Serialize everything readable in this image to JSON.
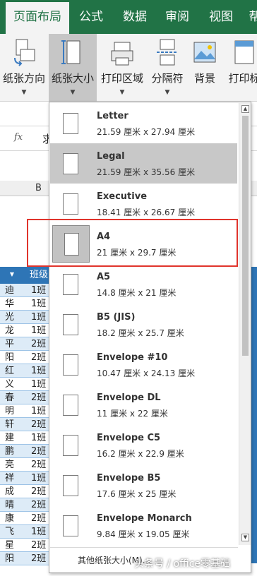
{
  "ribbon_tabs": [
    {
      "label": "页面布局",
      "active": true
    },
    {
      "label": "公式"
    },
    {
      "label": "数据"
    },
    {
      "label": "审阅"
    },
    {
      "label": "视图"
    },
    {
      "label": "帮"
    }
  ],
  "ribbon_buttons": [
    {
      "label": "纸张方向",
      "icon": "orientation-icon"
    },
    {
      "label": "纸张大小",
      "icon": "paper-size-icon",
      "selected": true
    },
    {
      "label": "打印区域",
      "icon": "print-area-icon"
    },
    {
      "label": "分隔符",
      "icon": "breaks-icon"
    },
    {
      "label": "背景",
      "icon": "background-icon"
    },
    {
      "label": "打印标",
      "icon": "print-titles-icon"
    }
  ],
  "formula_bar": {
    "fx_label": "fx",
    "value": "求"
  },
  "column_header": {
    "b": "B"
  },
  "table": {
    "header_col1": "▼",
    "header_col2": "班级",
    "rows": [
      [
        "迪",
        "1班"
      ],
      [
        "华",
        "1班"
      ],
      [
        "光",
        "1班"
      ],
      [
        "龙",
        "1班"
      ],
      [
        "平",
        "2班"
      ],
      [
        "阳",
        "2班"
      ],
      [
        "红",
        "1班"
      ],
      [
        "义",
        "1班"
      ],
      [
        "春",
        "2班"
      ],
      [
        "明",
        "1班"
      ],
      [
        "轩",
        "2班"
      ],
      [
        "建",
        "1班"
      ],
      [
        "鹏",
        "2班"
      ],
      [
        "亮",
        "2班"
      ],
      [
        "祥",
        "1班"
      ],
      [
        "成",
        "2班"
      ],
      [
        "晴",
        "2班"
      ],
      [
        "康",
        "2班"
      ],
      [
        "飞",
        "1班"
      ],
      [
        "星",
        "2班"
      ],
      [
        "阳",
        "2班"
      ]
    ]
  },
  "paper_sizes": [
    {
      "name": "Letter",
      "size": "21.59 厘米 x 27.94 厘米"
    },
    {
      "name": "Legal",
      "size": "21.59 厘米 x 35.56 厘米",
      "hover": true
    },
    {
      "name": "Executive",
      "size": "18.41 厘米 x 26.67 厘米"
    },
    {
      "name": "A4",
      "size": "21 厘米 x 29.7 厘米",
      "selected": true
    },
    {
      "name": "A5",
      "size": "14.8 厘米 x 21 厘米"
    },
    {
      "name": "B5 (JIS)",
      "size": "18.2 厘米 x 25.7 厘米"
    },
    {
      "name": "Envelope #10",
      "size": "10.47 厘米 x 24.13 厘米"
    },
    {
      "name": "Envelope DL",
      "size": "11 厘米 x 22 厘米"
    },
    {
      "name": "Envelope C5",
      "size": "16.2 厘米 x 22.9 厘米"
    },
    {
      "name": "Envelope B5",
      "size": "17.6 厘米 x 25 厘米"
    },
    {
      "name": "Envelope Monarch",
      "size": "9.84 厘米 x 19.05 厘米"
    }
  ],
  "more_sizes_label": "其他纸张大小(M)...",
  "watermark": "头条号 / office零基础",
  "colors": {
    "excel_green": "#217346",
    "header_blue": "#2e75b6",
    "highlight_red": "#e0342c"
  }
}
